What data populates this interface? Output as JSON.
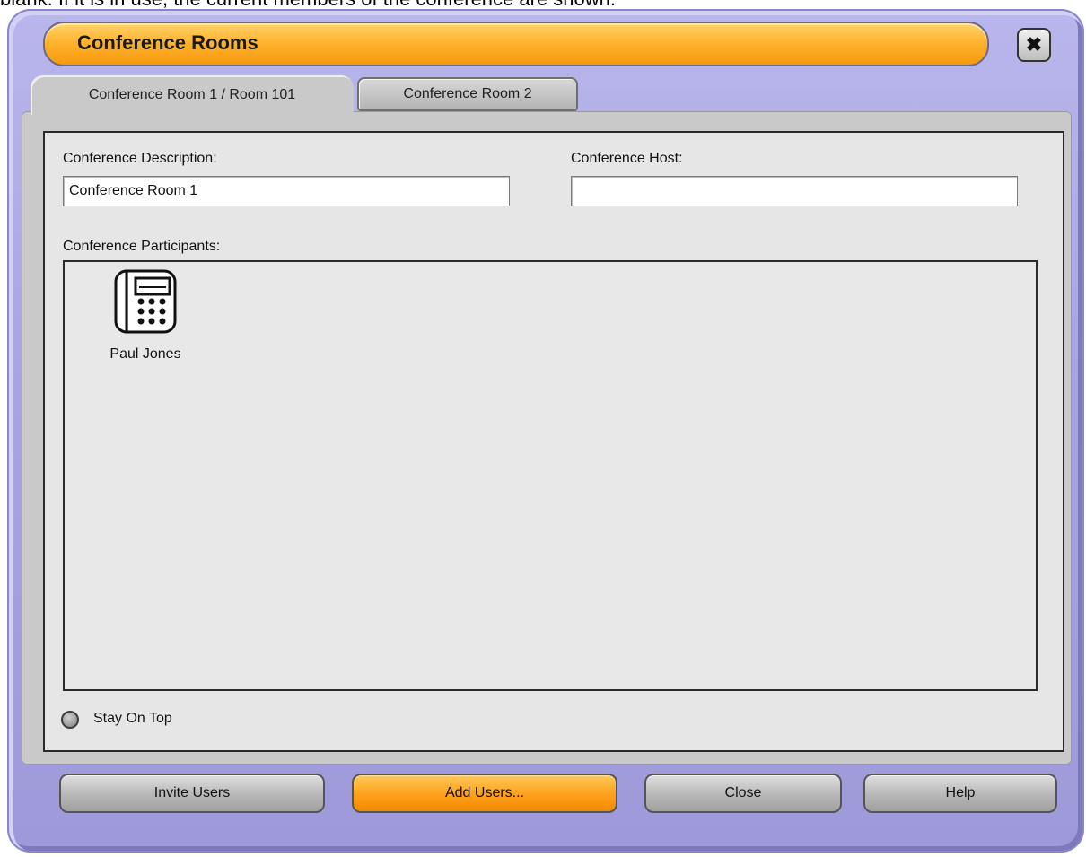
{
  "caption": "blank. If it is in use, the current members of the conference are shown.",
  "window": {
    "title": "Conference Rooms",
    "close_glyph": "✖",
    "accent_color": "#ffb12a",
    "frame_color": "#a8a4e3"
  },
  "tabs": [
    {
      "label": "Conference Room 1 / Room 101",
      "selected": true
    },
    {
      "label": "Conference Room 2",
      "selected": false
    }
  ],
  "form": {
    "description_label": "Conference Description:",
    "description_value": "Conference Room 1",
    "host_label": "Conference Host:",
    "host_value": "",
    "participants_label": "Conference Participants:"
  },
  "participants": [
    {
      "name": "Paul Jones",
      "icon": "desk-phone-icon"
    }
  ],
  "stay_on_top": {
    "label": "Stay On Top",
    "checked": false
  },
  "buttons": {
    "invite": "Invite Users",
    "add": "Add Users...",
    "close": "Close",
    "help": "Help"
  }
}
